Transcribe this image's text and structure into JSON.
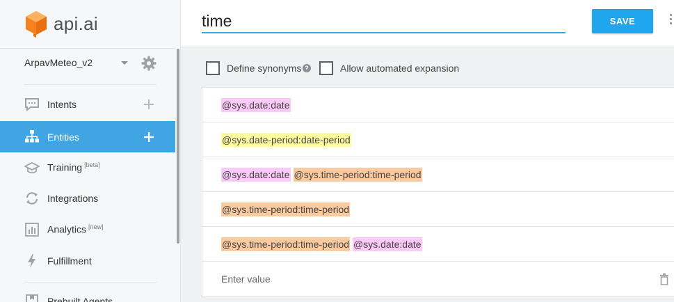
{
  "brand": {
    "name": "api.ai",
    "logo_color": "#f5821f"
  },
  "agent": {
    "name": "ArpavMeteo_v2"
  },
  "nav": [
    {
      "label": "Intents",
      "badge": "",
      "icon": "chat-bubble-icon",
      "has_plus": true,
      "active": false
    },
    {
      "label": "Entities",
      "badge": "",
      "icon": "sitemap-icon",
      "has_plus": true,
      "active": true
    },
    {
      "label": "Training",
      "badge": "[beta]",
      "icon": "graduation-cap-icon",
      "has_plus": false,
      "active": false
    },
    {
      "label": "Integrations",
      "badge": "",
      "icon": "sync-icon",
      "has_plus": false,
      "active": false
    },
    {
      "label": "Analytics",
      "badge": "[new]",
      "icon": "bar-chart-icon",
      "has_plus": false,
      "active": false
    },
    {
      "label": "Fulfillment",
      "badge": "",
      "icon": "lightning-icon",
      "has_plus": false,
      "active": false
    },
    {
      "label": "Prebuilt Agents",
      "badge": "",
      "icon": "bookmark-icon",
      "has_plus": false,
      "active": false
    }
  ],
  "entity": {
    "name": "time",
    "save_label": "SAVE",
    "define_synonyms_label": "Define synonyms",
    "define_synonyms_checked": false,
    "auto_expansion_label": "Allow automated expansion",
    "auto_expansion_checked": false,
    "values": [
      [
        {
          "text": "@sys.date:date",
          "kind": "date"
        }
      ],
      [
        {
          "text": "@sys.date-period:date-period",
          "kind": "date-period"
        }
      ],
      [
        {
          "text": "@sys.date:date",
          "kind": "date"
        },
        {
          "text": "@sys.time-period:time-period",
          "kind": "time-period"
        }
      ],
      [
        {
          "text": "@sys.time-period:time-period",
          "kind": "time-period"
        }
      ],
      [
        {
          "text": "@sys.time-period:time-period",
          "kind": "time-period"
        },
        {
          "text": "@sys.date:date",
          "kind": "date"
        }
      ]
    ],
    "enter_value_placeholder": "Enter value"
  },
  "colors": {
    "accent": "#42a5e3",
    "save_button": "#1fa6ec",
    "tag_date": "#fdc9f8",
    "tag_date_period": "#fdfca0",
    "tag_time_period": "#fcca9f"
  }
}
